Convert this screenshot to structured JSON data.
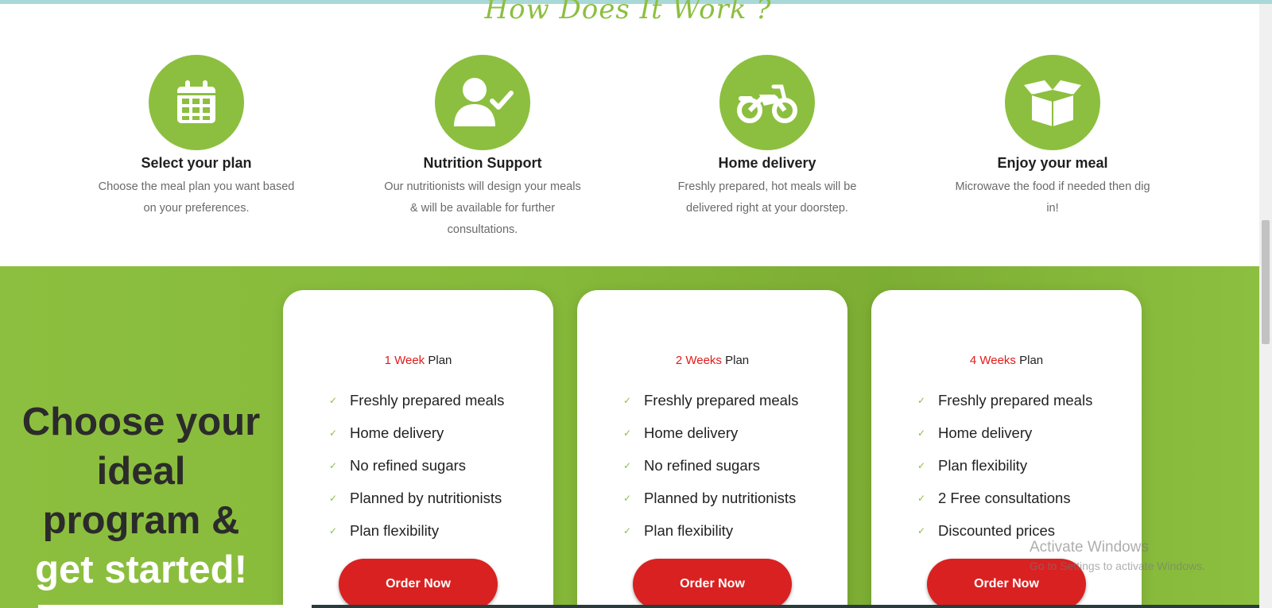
{
  "section_title": "How Does It Work ?",
  "steps": [
    {
      "icon": "calendar-icon",
      "title": "Select your plan",
      "desc": "Choose the meal plan you want based on your preferences."
    },
    {
      "icon": "user-check-icon",
      "title": "Nutrition Support",
      "desc": "Our nutritionists will design your meals & will be available for further consultations."
    },
    {
      "icon": "motorcycle-icon",
      "title": "Home delivery",
      "desc": "Freshly prepared, hot meals will be delivered right at your doorstep."
    },
    {
      "icon": "open-box-icon",
      "title": "Enjoy your meal",
      "desc": "Microwave the food if needed then dig in!"
    }
  ],
  "cta": {
    "dark": "Choose your ideal program &",
    "light": "get started!"
  },
  "plans": [
    {
      "duration": "1 Week",
      "suffix": "Plan",
      "features": [
        "Freshly prepared meals",
        "Home delivery",
        "No refined sugars",
        "Planned by nutritionists",
        "Plan flexibility"
      ],
      "button": "Order Now"
    },
    {
      "duration": "2 Weeks",
      "suffix": "Plan",
      "features": [
        "Freshly prepared meals",
        "Home delivery",
        "No refined sugars",
        "Planned by nutritionists",
        "Plan flexibility"
      ],
      "button": "Order Now"
    },
    {
      "duration": "4 Weeks",
      "suffix": "Plan",
      "features": [
        "Freshly prepared meals",
        "Home delivery",
        "Plan flexibility",
        "2 Free consultations",
        "Discounted prices"
      ],
      "button": "Order Now"
    }
  ],
  "check_glyph": "✓",
  "watermark": {
    "title": "Activate Windows",
    "subtitle": "Go to Settings to activate Windows."
  },
  "colors": {
    "accent_green": "#8cbf3f",
    "accent_red": "#e01b1b",
    "button_red": "#d92121"
  }
}
